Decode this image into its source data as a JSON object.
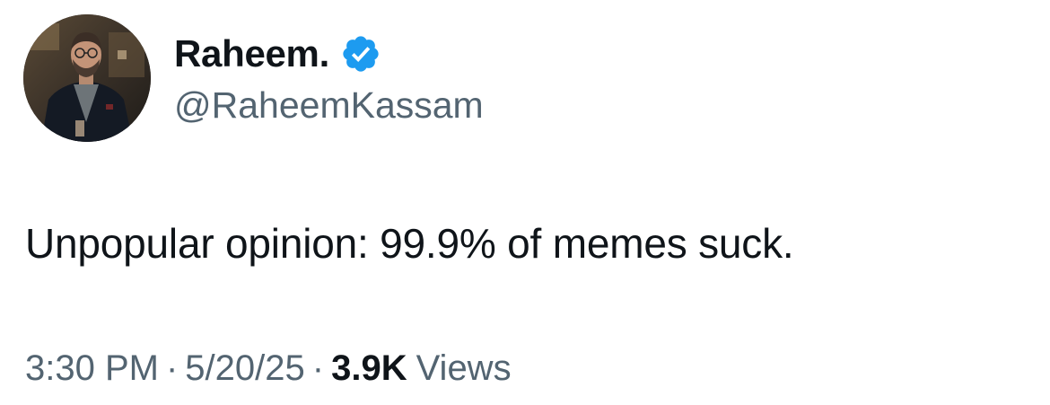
{
  "author": {
    "display_name": "Raheem.",
    "handle": "@RaheemKassam",
    "verified_badge_icon": "verified-check-badge",
    "avatar_icon": "profile-photo"
  },
  "tweet": {
    "text": "Unpopular opinion: 99.9% of memes suck."
  },
  "meta": {
    "time": "3:30 PM",
    "separator": "·",
    "date": "5/20/25",
    "views_count": "3.9K",
    "views_label": "Views"
  },
  "colors": {
    "primary_text": "#0f1419",
    "secondary_text": "#536471",
    "verified_blue": "#1d9bf0",
    "background": "#ffffff"
  }
}
